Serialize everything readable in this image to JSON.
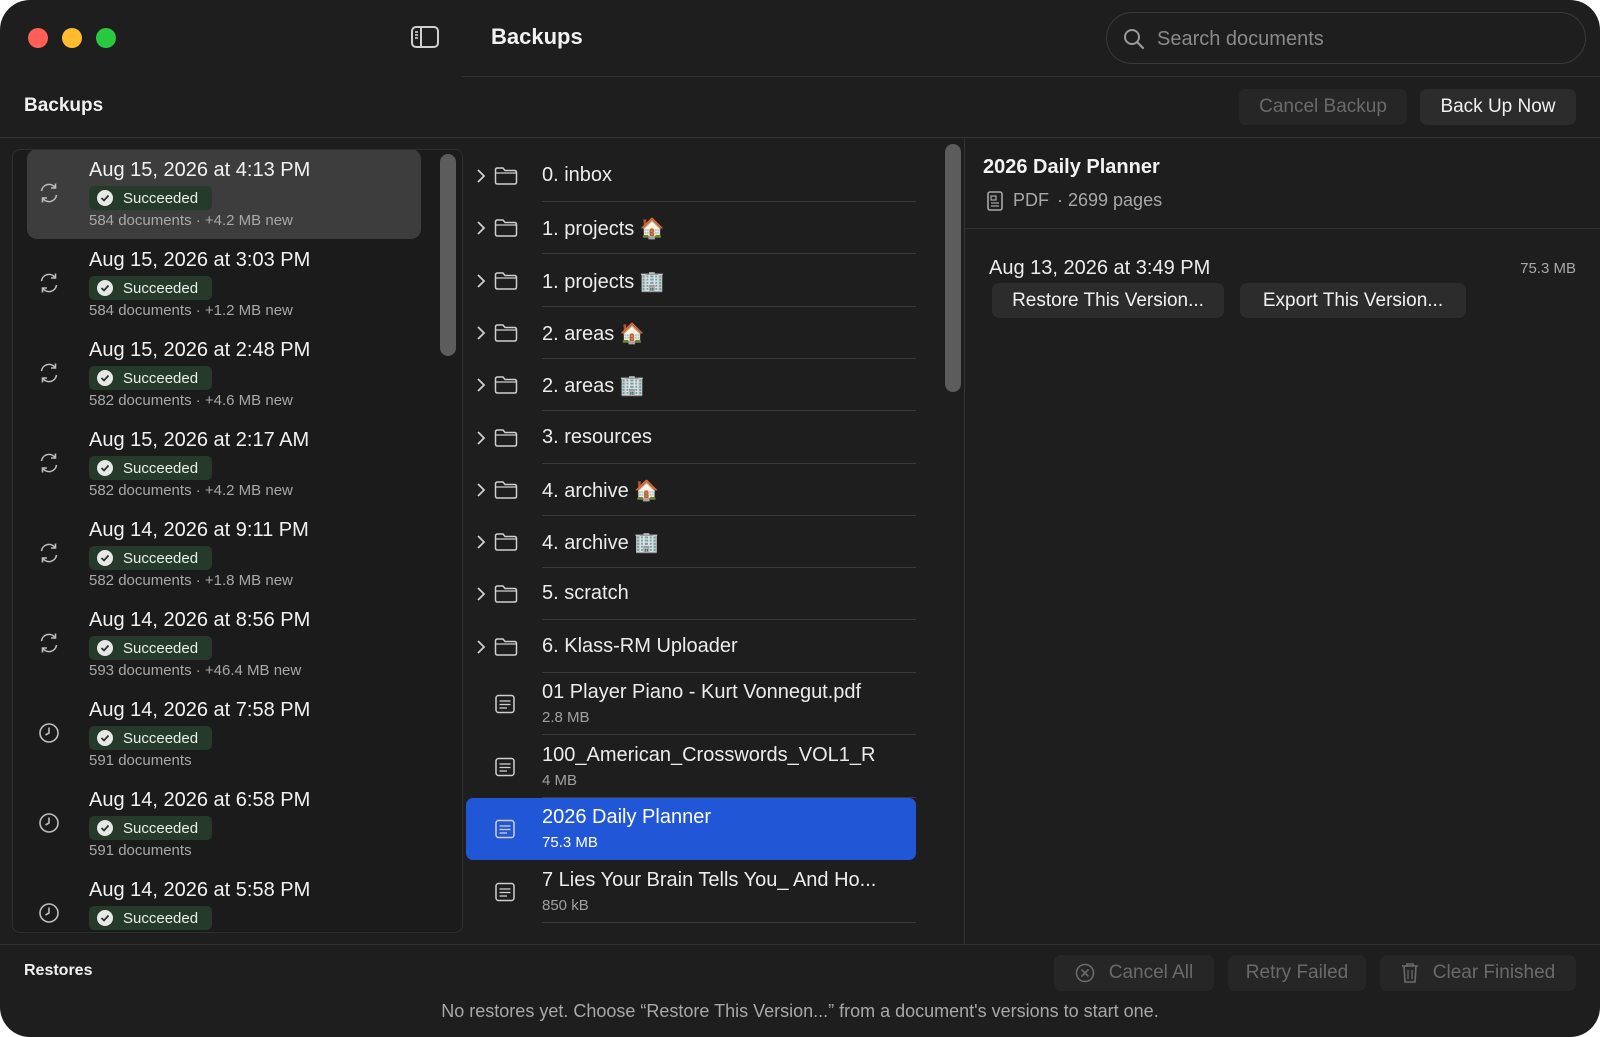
{
  "window": {
    "title": "Backups"
  },
  "search": {
    "placeholder": "Search documents",
    "value": ""
  },
  "sidebar": {
    "title": "Backups",
    "items": [
      {
        "date": "Aug 15, 2026 at 4:13 PM",
        "status": "Succeeded",
        "meta": "584 documents · +4.2 MB new",
        "icon": "sync-icon",
        "selected": true
      },
      {
        "date": "Aug 15, 2026 at 3:03 PM",
        "status": "Succeeded",
        "meta": "584 documents · +1.2 MB new",
        "icon": "sync-icon"
      },
      {
        "date": "Aug 15, 2026 at 2:48 PM",
        "status": "Succeeded",
        "meta": "582 documents · +4.6 MB new",
        "icon": "sync-icon"
      },
      {
        "date": "Aug 15, 2026 at 2:17 AM",
        "status": "Succeeded",
        "meta": "582 documents · +4.2 MB new",
        "icon": "sync-icon"
      },
      {
        "date": "Aug 14, 2026 at 9:11 PM",
        "status": "Succeeded",
        "meta": "582 documents · +1.8 MB new",
        "icon": "sync-icon"
      },
      {
        "date": "Aug 14, 2026 at 8:56 PM",
        "status": "Succeeded",
        "meta": "593 documents · +46.4 MB new",
        "icon": "sync-icon"
      },
      {
        "date": "Aug 14, 2026 at 7:58 PM",
        "status": "Succeeded",
        "meta": "591 documents",
        "icon": "clock-icon"
      },
      {
        "date": "Aug 14, 2026 at 6:58 PM",
        "status": "Succeeded",
        "meta": "591 documents",
        "icon": "clock-icon"
      },
      {
        "date": "Aug 14, 2026 at 5:58 PM",
        "status": "Succeeded",
        "meta": "",
        "icon": "clock-icon"
      }
    ]
  },
  "toolbar": {
    "cancel_backup": "Cancel Backup",
    "back_up_now": "Back Up Now"
  },
  "files": {
    "folders": [
      {
        "name": "0. inbox"
      },
      {
        "name": "1. projects 🏠"
      },
      {
        "name": "1. projects 🏢"
      },
      {
        "name": "2. areas 🏠"
      },
      {
        "name": "2. areas 🏢"
      },
      {
        "name": "3. resources"
      },
      {
        "name": "4. archive 🏠"
      },
      {
        "name": "4. archive 🏢"
      },
      {
        "name": "5. scratch"
      },
      {
        "name": "6. Klass-RM Uploader"
      }
    ],
    "documents": [
      {
        "name": "01 Player Piano - Kurt Vonnegut.pdf",
        "size": "2.8 MB"
      },
      {
        "name": "100_American_Crosswords_VOL1_R",
        "size": "4 MB"
      },
      {
        "name": "2026 Daily Planner",
        "size": "75.3 MB",
        "selected": true
      },
      {
        "name": "7 Lies Your Brain Tells You_ And Ho...",
        "size": "850 kB"
      }
    ]
  },
  "details": {
    "title": "2026 Daily Planner",
    "type": "PDF",
    "pages": "· 2699 pages",
    "version": {
      "date": "Aug 13, 2026 at 3:49 PM",
      "size": "75.3 MB",
      "restore": "Restore This Version...",
      "export": "Export This Version..."
    }
  },
  "restores": {
    "title": "Restores",
    "cancel_all": "Cancel All",
    "retry_failed": "Retry Failed",
    "clear_finished": "Clear Finished",
    "empty_message": "No restores yet. Choose “Restore This Version...” from a document's versions to start one."
  },
  "colors": {
    "accent": "#2157d6",
    "success_badge": "#253a2a",
    "background": "#1e1e1e"
  }
}
